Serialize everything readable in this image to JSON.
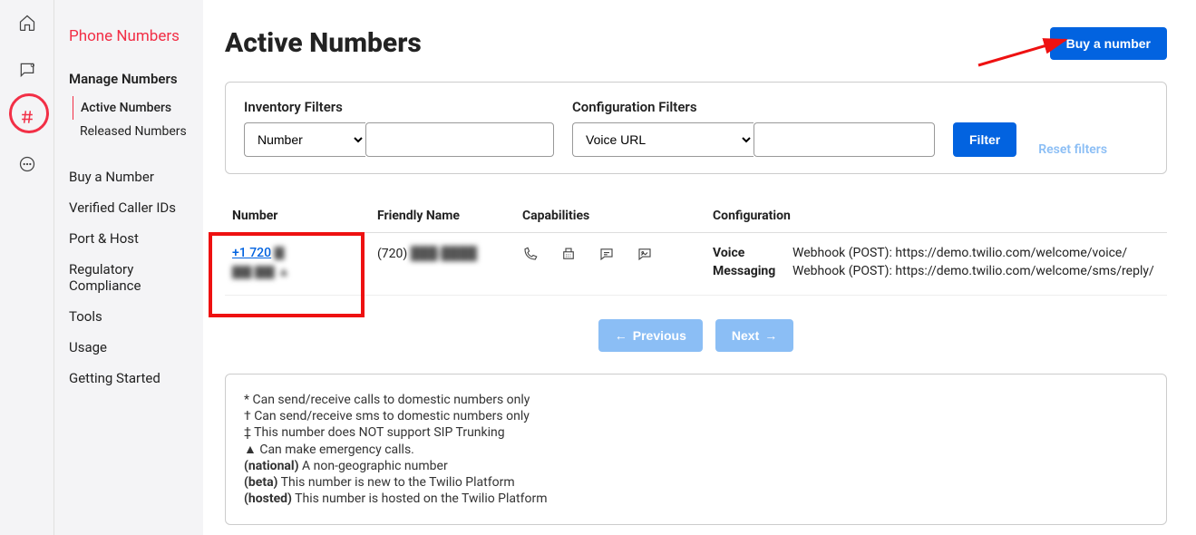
{
  "sidebar": {
    "title": "Phone Numbers",
    "manage_heading": "Manage Numbers",
    "active_numbers": "Active Numbers",
    "released_numbers": "Released Numbers",
    "items": [
      "Buy a Number",
      "Verified Caller IDs",
      "Port & Host",
      "Regulatory Compliance",
      "Tools",
      "Usage",
      "Getting Started"
    ]
  },
  "page": {
    "title": "Active Numbers",
    "buy_button": "Buy a number"
  },
  "filters": {
    "inventory_label": "Inventory Filters",
    "inventory_selected": "Number",
    "config_label": "Configuration Filters",
    "config_selected": "Voice URL",
    "filter_btn": "Filter",
    "reset": "Reset filters"
  },
  "table": {
    "cols": {
      "number": "Number",
      "friendly": "Friendly Name",
      "caps": "Capabilities",
      "config": "Configuration"
    },
    "row": {
      "number_link": "+1 720",
      "number_tail": "▇",
      "number_line2": "▇▇ ▇▇   ▲",
      "friendly": "(720) ███-████",
      "cfg_voice_key": "Voice",
      "cfg_msg_key": "Messaging",
      "cfg_voice": "Webhook (POST): https://demo.twilio.com/welcome/voice/",
      "cfg_msg": "Webhook (POST): https://demo.twilio.com/welcome/sms/reply/"
    }
  },
  "pager": {
    "prev": "Previous",
    "next": "Next"
  },
  "legend": {
    "l1": "* Can send/receive calls to domestic numbers only",
    "l2": "† Can send/receive sms to domestic numbers only",
    "l3": "‡ This number does NOT support SIP Trunking",
    "l4": "▲ Can make emergency calls.",
    "l5a": "(national)",
    "l5b": " A non-geographic number",
    "l6a": "(beta)",
    "l6b": " This number is new to the Twilio Platform",
    "l7a": "(hosted)",
    "l7b": " This number is hosted on the Twilio Platform"
  }
}
